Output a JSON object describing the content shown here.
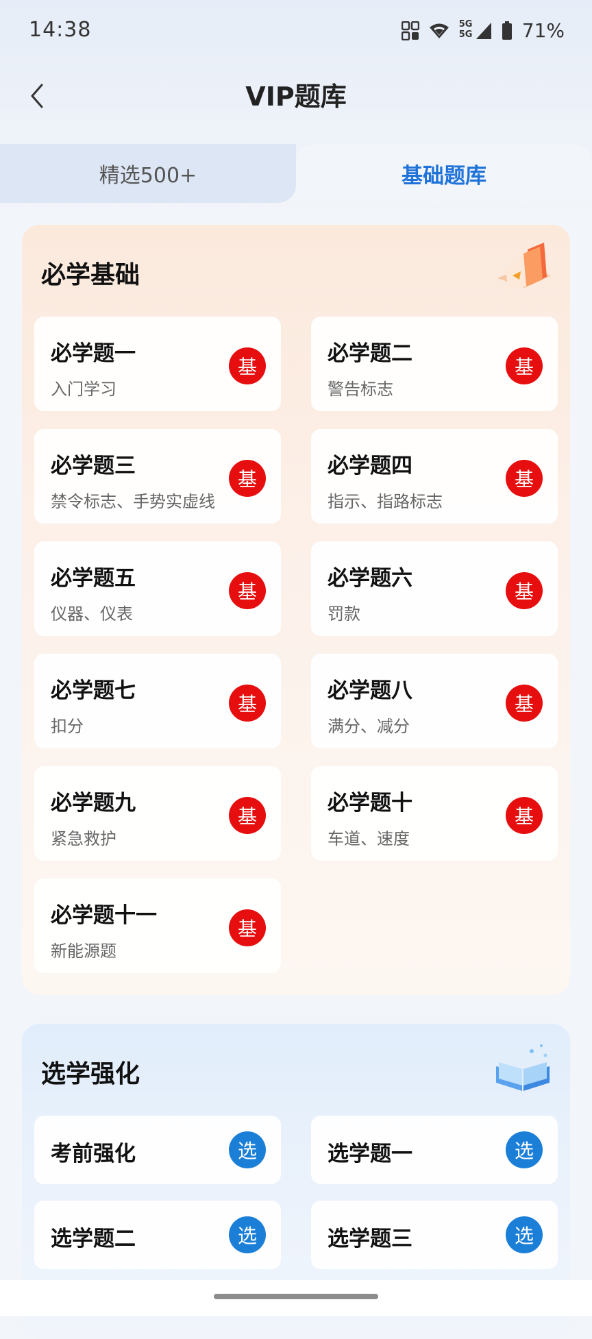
{
  "status_bar": {
    "time": "14:38",
    "network": "5G",
    "network2": "5G",
    "battery": "71%"
  },
  "header": {
    "title": "VIP题库"
  },
  "tabs": [
    {
      "label": "精选500+",
      "active": false
    },
    {
      "label": "基础题库",
      "active": true
    }
  ],
  "colors": {
    "accent_blue": "#1f73d8",
    "badge_red": "#e60e0e",
    "badge_blue": "#1b7fd8"
  },
  "sections": {
    "basic": {
      "title": "必学基础",
      "illustration": "book-stack-illustration",
      "badge_label": "基",
      "items": [
        {
          "title": "必学题一",
          "subtitle": "入门学习"
        },
        {
          "title": "必学题二",
          "subtitle": "警告标志"
        },
        {
          "title": "必学题三",
          "subtitle": "禁令标志、手势实虚线"
        },
        {
          "title": "必学题四",
          "subtitle": "指示、指路标志"
        },
        {
          "title": "必学题五",
          "subtitle": "仪器、仪表"
        },
        {
          "title": "必学题六",
          "subtitle": "罚款"
        },
        {
          "title": "必学题七",
          "subtitle": "扣分"
        },
        {
          "title": "必学题八",
          "subtitle": "满分、减分"
        },
        {
          "title": "必学题九",
          "subtitle": "紧急救护"
        },
        {
          "title": "必学题十",
          "subtitle": "车道、速度"
        },
        {
          "title": "必学题十一",
          "subtitle": "新能源题"
        }
      ]
    },
    "elective": {
      "title": "选学强化",
      "illustration": "open-book-illustration",
      "badge_label": "选",
      "items": [
        {
          "title": "考前强化"
        },
        {
          "title": "选学题一"
        },
        {
          "title": "选学题二"
        },
        {
          "title": "选学题三"
        }
      ]
    }
  }
}
